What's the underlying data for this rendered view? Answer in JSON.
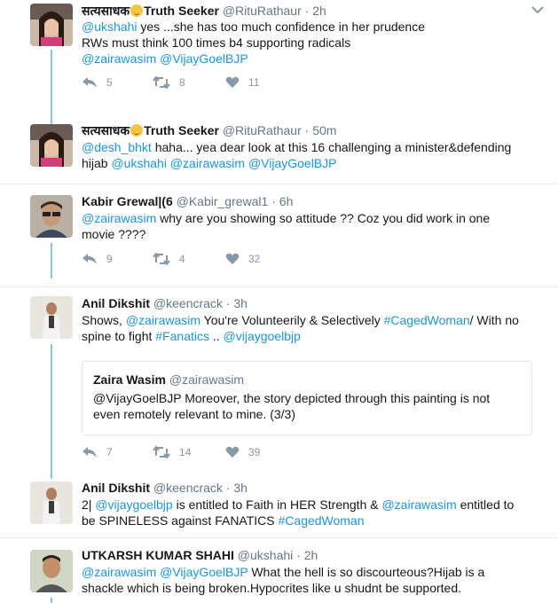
{
  "tweets": [
    {
      "name_prefix": "सत्यसाधक",
      "name_suffix": "Truth Seeker",
      "handle": "@RituRathaur",
      "time": "2h",
      "lines": [
        [
          "@ukshahi",
          " yes ...she has too much confidence in her prudence"
        ],
        [
          "RWs must think 100 times b4 supporting radicals"
        ],
        [
          "@zairawasim",
          " ",
          "@VijayGoelBJP"
        ]
      ],
      "replies": "5",
      "retweets": "8",
      "likes": "11"
    },
    {
      "name_prefix": "सत्यसाधक",
      "name_suffix": "Truth Seeker",
      "handle": "@RituRathaur",
      "time": "50m",
      "lines": [
        [
          "@desh_bhkt",
          " haha... yea dear look at this 16 challenging a minister&defending"
        ],
        [
          "hijab ",
          "@ukshahi",
          " ",
          "@zairawasim",
          " ",
          "@VijayGoelBJP"
        ]
      ]
    },
    {
      "name": "Kabir Grewal|(6",
      "handle": "@Kabir_grewal1",
      "time": "6h",
      "lines": [
        [
          "@zairawasim",
          " why are you showing so attitude ?? Coz you did work in one"
        ],
        [
          "movie ????"
        ]
      ],
      "replies": "9",
      "retweets": "4",
      "likes": "32"
    },
    {
      "name": "Anil Dikshit",
      "handle": "@keencrack",
      "time": "3h",
      "lines": [
        [
          "Shows, ",
          "@zairawasim",
          " You're Volunteerily & Selectively ",
          "#CagedWoman",
          "/ With no"
        ],
        [
          "spine to fight ",
          "#Fanatics",
          " .. ",
          "@vijaygoelbjp"
        ]
      ],
      "quote": {
        "name": "Zaira Wasim",
        "handle": "@zairawasim",
        "line1": "@VijayGoelBJP Moreover, the story depicted through this painting is not",
        "line2": "even remotely relevant to mine. (3/3)"
      },
      "replies": "7",
      "retweets": "14",
      "likes": "39"
    },
    {
      "name": "Anil Dikshit",
      "handle": "@keencrack",
      "time": "3h",
      "lines": [
        [
          "2| ",
          "@vijaygoelbjp",
          " is entitled to Faith in HER Strength & ",
          "@zairawasim",
          " entitled to"
        ],
        [
          "be SPINELESS against FANATICS ",
          "#CagedWoman"
        ]
      ]
    },
    {
      "name": "UTKARSH KUMAR SHAHI",
      "handle": "@ukshahi",
      "time": "2h",
      "lines": [
        [
          "@zairawasim",
          " ",
          "@VijayGoelBJP",
          " What the hell is so discourteous?Hijab is a"
        ],
        [
          "shackle which is being broken.Hypocrites like u shudnt be supported."
        ]
      ]
    }
  ],
  "dot": "·",
  "colors": {
    "link": "#1b95e0",
    "thread": "#8ec3e6",
    "meta": "#657786",
    "action": "#8899a6"
  }
}
